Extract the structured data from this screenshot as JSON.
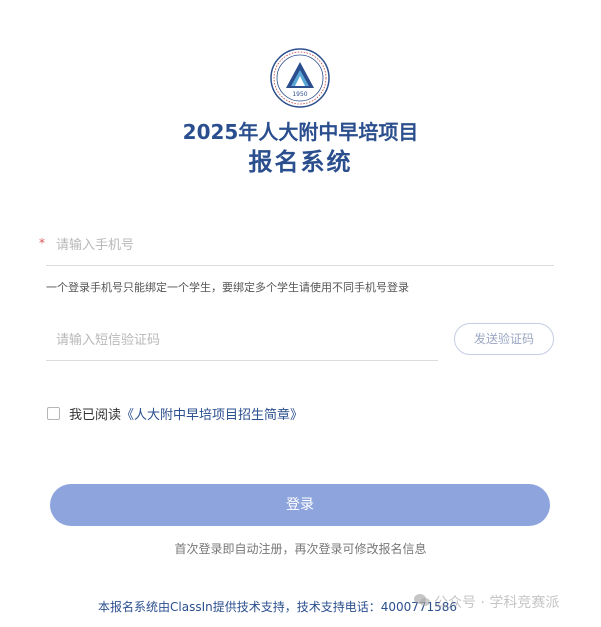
{
  "header": {
    "title_line1": "2025年人大附中早培项目",
    "title_line2": "报名系统",
    "logo_text": "1950"
  },
  "form": {
    "required_mark": "*",
    "phone_placeholder": "请输入手机号",
    "phone_hint": "一个登录手机号只能绑定一个学生，要绑定多个学生请使用不同手机号登录",
    "code_placeholder": "请输入短信验证码",
    "send_code_label": "发送验证码",
    "agree_prefix": "我已阅读",
    "agree_link": "《人大附中早培项目招生简章》",
    "agree_checked": false
  },
  "login": {
    "button_label": "登录",
    "note": "首次登录即自动注册，再次登录可修改报名信息"
  },
  "footer": {
    "support_text": "本报名系统由ClassIn提供技术支持，技术支持电话：4000771586"
  },
  "watermark": {
    "text": "公众号 · 学科竞赛派"
  },
  "colors": {
    "brand": "#2b4f8e",
    "button": "#8ea4dd",
    "required": "#e05555"
  }
}
